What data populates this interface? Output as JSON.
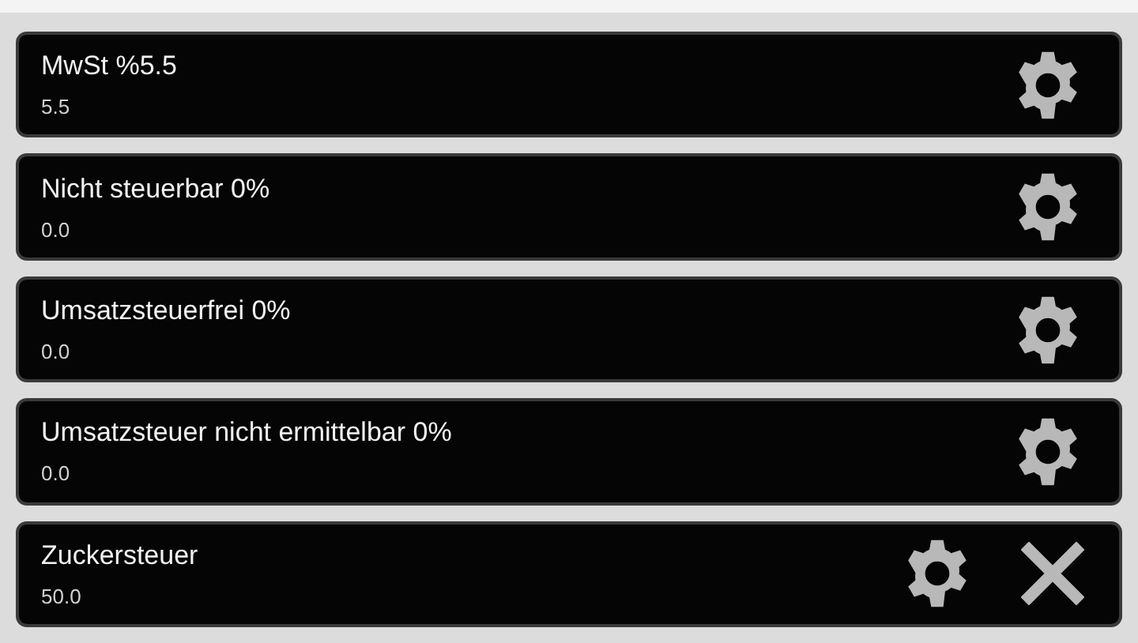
{
  "tax_rates": [
    {
      "title": "MwSt %5.5",
      "value": "5.5",
      "deletable": false
    },
    {
      "title": "Nicht steuerbar 0%",
      "value": "0.0",
      "deletable": false
    },
    {
      "title": "Umsatzsteuerfrei 0%",
      "value": "0.0",
      "deletable": false
    },
    {
      "title": "Umsatzsteuer nicht ermittelbar 0%",
      "value": "0.0",
      "deletable": false
    },
    {
      "title": "Zuckersteuer",
      "value": "50.0",
      "deletable": true
    }
  ]
}
